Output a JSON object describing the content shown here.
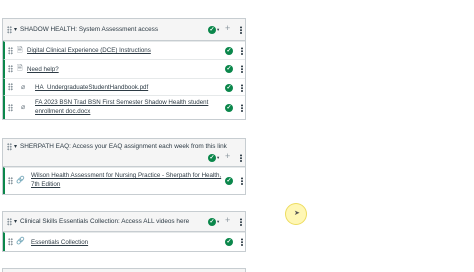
{
  "modules": [
    {
      "title": "SHADOW HEALTH: System Assessment access",
      "items": [
        {
          "title": "Digital Clinical Experience (DCE) Instructions",
          "icon": "page-icon"
        },
        {
          "title": "Need help?",
          "icon": "page-icon"
        },
        {
          "title": "HA_UndergraduateStudentHandbook.pdf",
          "icon": "attachment-icon"
        },
        {
          "title_line1": "FA 2023 BSN Trad BSN First Semester Shadow Health student",
          "title_line2": "enrollment doc.docx",
          "icon": "attachment-icon"
        }
      ]
    },
    {
      "title": "SHERPATH EAQ: Access your EAQ assignment each week from this link",
      "items": [
        {
          "title_line1": "Wilson Health Assessment for Nursing Practice - Sherpath for Health,",
          "title_line2": "7th Edition",
          "icon": "link-icon"
        }
      ]
    },
    {
      "title": "Clinical Skills Essentials Collection: Access ALL videos here",
      "items": [
        {
          "title": "Essentials Collection",
          "icon": "link-icon"
        }
      ]
    }
  ],
  "glyphs": {
    "caret_down": "▾",
    "check": "✓",
    "plus": "+",
    "page": "🗎",
    "attachment": "⌀",
    "link": "🔗"
  },
  "colors": {
    "published_green": "#0b874b",
    "header_bg": "#f5f5f5",
    "border": "#c7cdd1",
    "text": "#2d3b45"
  }
}
